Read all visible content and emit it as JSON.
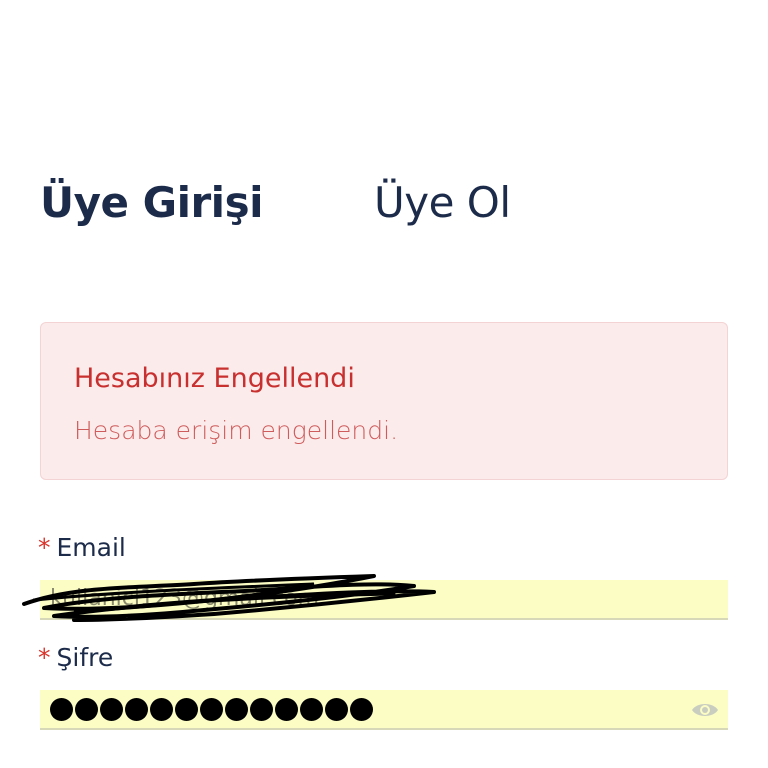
{
  "tabs": {
    "login": "Üye Girişi",
    "register": "Üye Ol"
  },
  "alert": {
    "title": "Hesabınız Engellendi",
    "message": "Hesaba erişim engellendi."
  },
  "form": {
    "email": {
      "label": "Email",
      "required_mark": "*",
      "value": "kullanici123@gmail.com"
    },
    "password": {
      "label": "Şifre",
      "required_mark": "*",
      "dot_count": 13
    }
  },
  "icons": {
    "show_password": "eye-icon"
  },
  "colors": {
    "primary_text": "#1c2b4a",
    "alert_title": "#c8302f",
    "alert_bg": "#fcebeb",
    "input_bg": "#fbfdc4",
    "required": "#d9342b"
  }
}
